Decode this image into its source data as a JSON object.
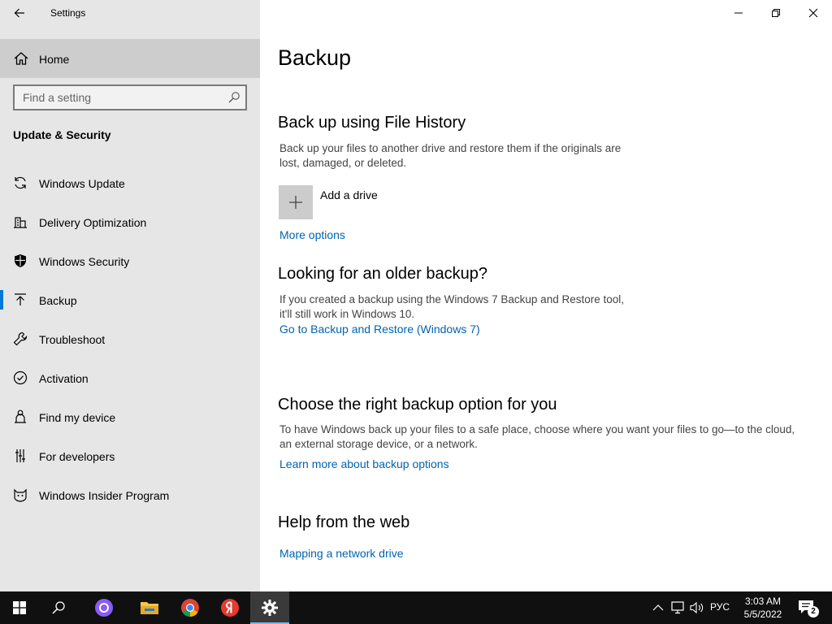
{
  "window": {
    "title": "Settings",
    "back_icon": "arrow-left-icon",
    "minimize_icon": "minimize-icon",
    "restore_icon": "restore-icon",
    "close_icon": "close-icon"
  },
  "sidebar": {
    "home_label": "Home",
    "search_placeholder": "Find a setting",
    "section_title": "Update & Security",
    "accent_color": "#0078d7",
    "items": [
      {
        "label": "Windows Update",
        "icon": "sync-icon"
      },
      {
        "label": "Delivery Optimization",
        "icon": "delivery-optimization-icon"
      },
      {
        "label": "Windows Security",
        "icon": "shield-icon"
      },
      {
        "label": "Backup",
        "icon": "backup-arrow-icon",
        "active": true
      },
      {
        "label": "Troubleshoot",
        "icon": "wrench-icon"
      },
      {
        "label": "Activation",
        "icon": "check-circle-icon"
      },
      {
        "label": "Find my device",
        "icon": "person-location-icon"
      },
      {
        "label": "For developers",
        "icon": "developer-tools-icon"
      },
      {
        "label": "Windows Insider Program",
        "icon": "insider-cat-icon"
      }
    ]
  },
  "main": {
    "page_title": "Backup",
    "file_history": {
      "heading": "Back up using File History",
      "description_line1": "Back up your files to another drive and restore them if the originals are",
      "description_line2": "lost, damaged, or deleted.",
      "add_drive_label": "Add a drive",
      "more_options": "More options"
    },
    "older_backup": {
      "heading": "Looking for an older backup?",
      "description_line1": "If you created a backup using the Windows 7 Backup and Restore tool,",
      "description_line2": "it'll still work in Windows 10.",
      "link": "Go to Backup and Restore (Windows 7)"
    },
    "choose_option": {
      "heading": "Choose the right backup option for you",
      "description_line1": "To have Windows back up your files to a safe place, choose where you want your files to go—to the cloud,",
      "description_line2": "an external storage device, or a network.",
      "link": "Learn more about backup options"
    },
    "help_web": {
      "heading": "Help from the web",
      "link": "Mapping a network drive"
    },
    "link_color": "#0063b1"
  },
  "taskbar": {
    "apps": [
      {
        "icon": "windows-start-icon"
      },
      {
        "icon": "search-icon"
      },
      {
        "icon": "alice-assistant-icon"
      },
      {
        "icon": "file-explorer-icon"
      },
      {
        "icon": "chrome-icon"
      },
      {
        "icon": "yandex-browser-icon"
      },
      {
        "icon": "settings-gear-icon",
        "active": true
      }
    ],
    "tray": {
      "language": "РУС",
      "time": "3:03 AM",
      "date": "5/5/2022",
      "notifications_count": "2"
    }
  }
}
